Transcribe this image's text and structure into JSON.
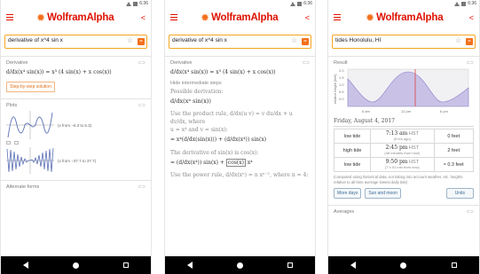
{
  "status": {
    "time": "6:36"
  },
  "app": {
    "logo": "WolframAlpha"
  },
  "screen1": {
    "query": "derivative of x^4 sin x",
    "pods": {
      "derivative": {
        "title": "Derivative",
        "expr_lhs": "d/dx(x⁴ sin(x))",
        "expr_rhs": "= x³ (4 sin(x) + x cos(x))",
        "step_button": "Step-by-step solution"
      },
      "plots": {
        "title": "Plots",
        "plot1_caption": "(x from −6.3 to 6.3)",
        "plot2_caption": "(x from −37.7 to 37.7)"
      },
      "alternate": {
        "title": "Alternate forms"
      }
    }
  },
  "screen2": {
    "query": "derivative of x^4 sin x",
    "pods": {
      "derivative": {
        "title": "Derivative",
        "expr_lhs": "d/dx(x⁴ sin(x))",
        "expr_rhs": "= x³ (4 sin(x) + x cos(x))",
        "hide_steps": "Hide intermediate steps",
        "possible_derivation": "Possible derivation:",
        "deriv_expr": "d/dx(x⁴ sin(x))",
        "product_rule": "Use the product rule, d/dx(u v) = v du/dx + u dv/dx, where",
        "uv_def": "u = x⁴ and v = sin(x):",
        "product_expr_a": "= x⁴(d/dx(sin(x)))",
        "product_expr_b": "+ (d/dx(x⁴)) sin(x)",
        "sin_deriv": "The derivative of sin(x) is cos(x):",
        "sin_expr_a": "= (d/dx(x⁴)) sin(x) +",
        "sin_expr_b": "cos(x)",
        "sin_expr_c": "x⁴",
        "power_rule": "Use the power rule, d/dx(xⁿ) = n xⁿ⁻¹, where n = 4:"
      }
    }
  },
  "screen3": {
    "query": "tides Honolulu, HI",
    "result_title": "Result",
    "chart_ylabel": "relative height (feet)",
    "chart_ticks": [
      "6 am",
      "12 pm",
      "6 pm"
    ],
    "date": "Friday, August 4, 2017",
    "table": [
      {
        "type": "low tide",
        "time": "7:13 am",
        "zone": "HST",
        "sub": "(5 hrs ago)",
        "height": "0 feet"
      },
      {
        "type": "high tide",
        "time": "2:45 pm",
        "zone": "HST",
        "sub": "(48 minutes from now)",
        "height": "2 feet"
      },
      {
        "type": "low tide",
        "time": "9:50 pm",
        "zone": "HST",
        "sub": "(7 h  51 min from now)",
        "height": "≈ 0.3 feet"
      }
    ],
    "footnote": "(computed using historical data, not taking into account weather, etc. heights relative to all-time average lowest daily tide)",
    "buttons": {
      "more_days": "More days",
      "sun_moon": "Sun and moon",
      "units": "Units"
    },
    "averages_title": "Averages"
  },
  "colors": {
    "accent": "#dd1100",
    "orange": "#f3701c",
    "search_border": "#f5a623",
    "chart_fill": "#c9c2e6",
    "now_line": "#e04040"
  },
  "icons": [
    "menu-icon",
    "share-icon",
    "star-icon",
    "go-icon",
    "link-icon",
    "back-icon",
    "home-icon",
    "recent-apps-icon"
  ]
}
